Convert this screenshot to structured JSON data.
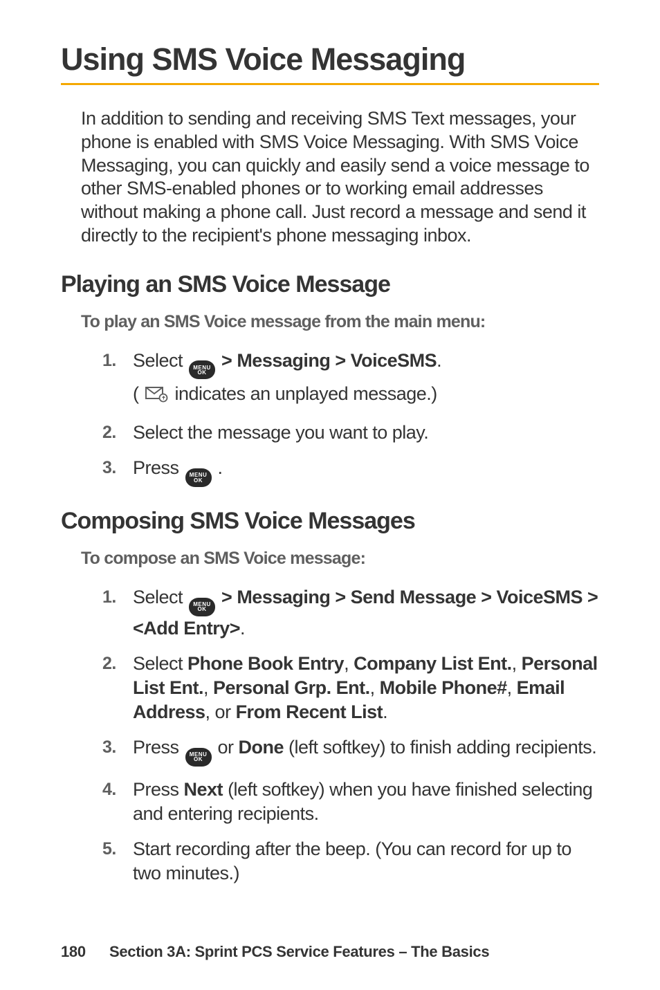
{
  "title": "Using SMS Voice Messaging",
  "intro": "In addition to sending and receiving SMS Text messages, your phone is enabled with SMS Voice Messaging. With SMS Voice Messaging, you can quickly and easily send a voice message to other SMS-enabled phones or to working email addresses without making a phone call. Just record a message and send it directly to the recipient's phone messaging inbox.",
  "section1": {
    "heading": "Playing an SMS Voice Message",
    "subhead": "To play an SMS Voice message from the main menu:",
    "steps": {
      "s1_pre": "Select ",
      "s1_path": " > Messaging > VoiceSMS",
      "s1_dot": ".",
      "s1_sub_pre": "( ",
      "s1_sub_post": " indicates an unplayed message.)",
      "s2": "Select the message you want to play.",
      "s3_pre": "Press ",
      "s3_post": " ."
    }
  },
  "section2": {
    "heading": "Composing SMS Voice Messages",
    "subhead": "To compose an SMS Voice message:",
    "steps": {
      "s1_pre": "Select ",
      "s1_path": " > Messaging > Send Message > VoiceSMS > <Add Entry>",
      "s1_dot": ".",
      "s2_pre": "Select ",
      "s2_b1": "Phone Book Entry",
      "s2_c1": ",  ",
      "s2_b2": "Company List Ent.",
      "s2_c2": ", ",
      "s2_b3": "Personal List Ent.",
      "s2_c3": ",  ",
      "s2_b4": "Personal Grp. Ent.",
      "s2_c4": ",  ",
      "s2_b5": "Mobile Phone#",
      "s2_c5": ", ",
      "s2_b6": "Email Address",
      "s2_c6": ", or  ",
      "s2_b7": "From Recent List",
      "s2_dot": ".",
      "s3_pre": "Press ",
      "s3_mid": " or ",
      "s3_b": "Done",
      "s3_post": " (left softkey) to finish adding recipients.",
      "s4_pre": "Press ",
      "s4_b": "Next",
      "s4_post": " (left softkey) when you have finished selecting and entering recipients.",
      "s5": "Start recording after the beep. (You can record for up to two minutes.)"
    }
  },
  "footer": {
    "page": "180",
    "section": "Section 3A: Sprint PCS Service Features – The Basics"
  },
  "icons": {
    "menu_top": "MENU",
    "menu_bot": "OK"
  }
}
